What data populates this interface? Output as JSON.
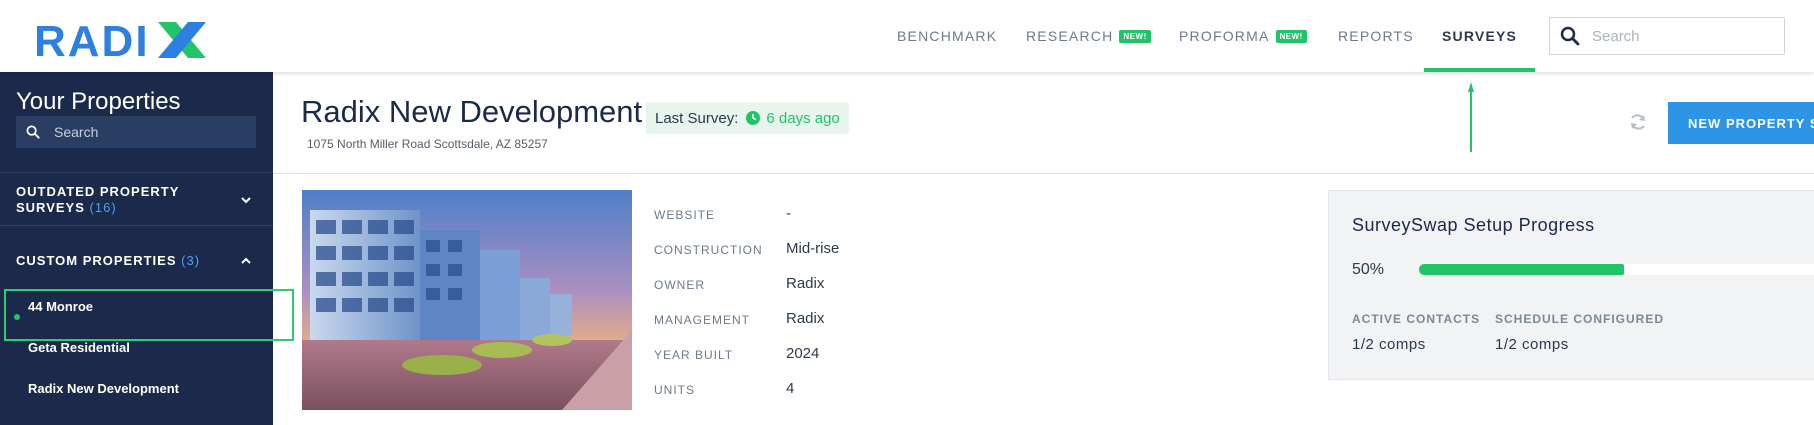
{
  "brand": {
    "logo_text": "RADIX"
  },
  "nav": {
    "items": [
      {
        "label": "BENCHMARK",
        "badge": ""
      },
      {
        "label": "RESEARCH",
        "badge": "NEW!"
      },
      {
        "label": "PROFORMA",
        "badge": "NEW!"
      },
      {
        "label": "REPORTS",
        "badge": ""
      },
      {
        "label": "SURVEYS",
        "badge": ""
      }
    ],
    "active": "SURVEYS",
    "search_placeholder": "Search"
  },
  "sidebar": {
    "title": "Your Properties",
    "search_placeholder": "Search",
    "sections": [
      {
        "label": "OUTDATED PROPERTY SURVEYS",
        "count": "(16)",
        "expanded": false
      },
      {
        "label": "CUSTOM PROPERTIES",
        "count": "(3)",
        "expanded": true
      }
    ],
    "items": [
      {
        "label": "44 Monroe"
      },
      {
        "label": "Geta Residential"
      },
      {
        "label": "Radix New Development",
        "selected": true
      }
    ]
  },
  "property": {
    "name": "Radix New Development",
    "address": "1075 North Miller Road Scottsdale, AZ 85257",
    "last_survey_label": "Last Survey:",
    "last_survey_value": "6 days ago",
    "new_survey_button": "NEW PROPERTY SURVEY",
    "details": [
      {
        "label": "WEBSITE",
        "value": "-"
      },
      {
        "label": "CONSTRUCTION",
        "value": "Mid-rise"
      },
      {
        "label": "OWNER",
        "value": "Radix"
      },
      {
        "label": "MANAGEMENT",
        "value": "Radix"
      },
      {
        "label": "YEAR BUILT",
        "value": "2024"
      },
      {
        "label": "UNITS",
        "value": "4"
      }
    ]
  },
  "progress": {
    "title": "SurveySwap Setup Progress",
    "percent_label": "50%",
    "percent": 0.5,
    "stats": [
      {
        "label": "ACTIVE CONTACTS",
        "value": "1/2 comps"
      },
      {
        "label": "SCHEDULE CONFIGURED",
        "value": "1/2 comps"
      }
    ]
  },
  "colors": {
    "accent_green": "#22c46a",
    "sidebar_bg": "#1b2a4a",
    "button_blue": "#2d94e6",
    "count_blue": "#4aa3f0"
  }
}
